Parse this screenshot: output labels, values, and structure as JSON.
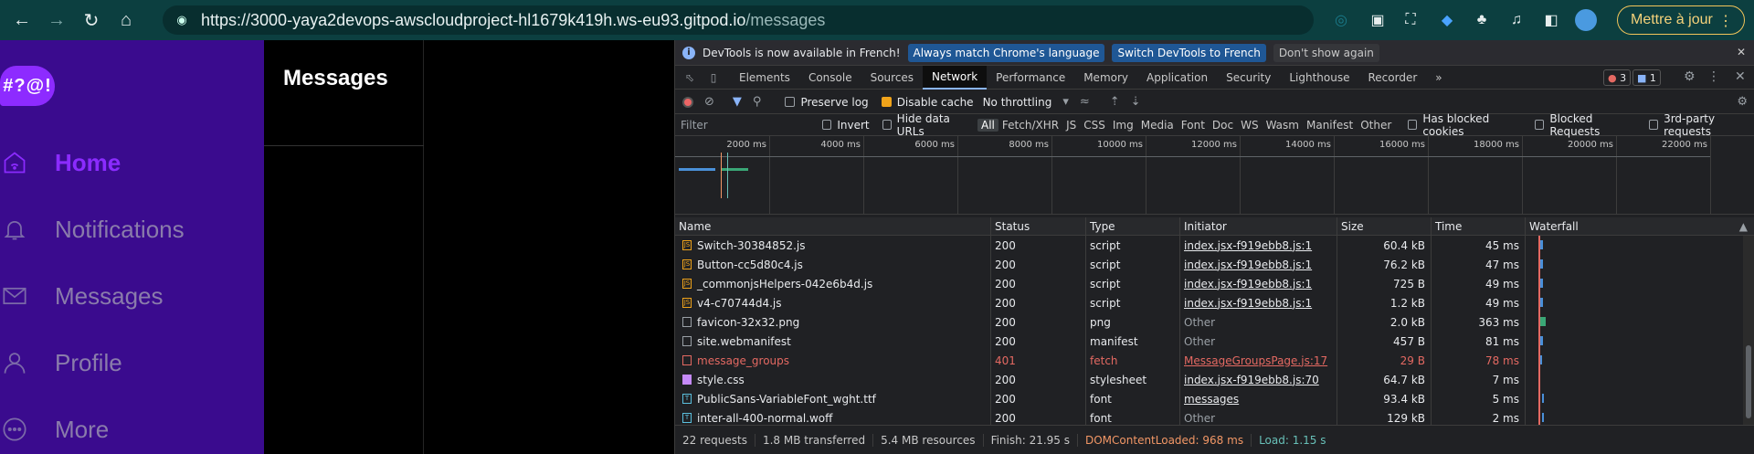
{
  "browser": {
    "url_host": "https://3000-yaya2devops-awscloudproject-hl1679k419h.ws-eu93.gitpod.io",
    "url_path": "/messages",
    "update_button": "Mettre à jour"
  },
  "app": {
    "logo_text": "#?@!",
    "menu": [
      {
        "label": "Home",
        "icon": "home-icon",
        "active": true
      },
      {
        "label": "Notifications",
        "icon": "bell-icon",
        "active": false
      },
      {
        "label": "Messages",
        "icon": "mail-icon",
        "active": false
      },
      {
        "label": "Profile",
        "icon": "user-icon",
        "active": false
      },
      {
        "label": "More",
        "icon": "more-icon",
        "active": false
      }
    ],
    "page_title": "Messages"
  },
  "devtools": {
    "infobar": {
      "message": "DevTools is now available in French!",
      "btn_match": "Always match Chrome's language",
      "btn_switch": "Switch DevTools to French",
      "btn_dismiss": "Don't show again"
    },
    "tabs": [
      "Elements",
      "Console",
      "Sources",
      "Network",
      "Performance",
      "Memory",
      "Application",
      "Security",
      "Lighthouse",
      "Recorder"
    ],
    "active_tab": "Network",
    "error_count": "3",
    "message_count": "1",
    "toolbar": {
      "preserve_log": "Preserve log",
      "disable_cache": "Disable cache",
      "throttling": "No throttling"
    },
    "filter": {
      "placeholder": "Filter",
      "invert": "Invert",
      "hide_data_urls": "Hide data URLs",
      "types": [
        "All",
        "Fetch/XHR",
        "JS",
        "CSS",
        "Img",
        "Media",
        "Font",
        "Doc",
        "WS",
        "Wasm",
        "Manifest",
        "Other"
      ],
      "has_blocked_cookies": "Has blocked cookies",
      "blocked_requests": "Blocked Requests",
      "third_party": "3rd-party requests"
    },
    "timeline_labels": [
      "2000 ms",
      "4000 ms",
      "6000 ms",
      "8000 ms",
      "10000 ms",
      "12000 ms",
      "14000 ms",
      "16000 ms",
      "18000 ms",
      "20000 ms",
      "22000 ms"
    ],
    "columns": [
      "Name",
      "Status",
      "Type",
      "Initiator",
      "Size",
      "Time",
      "Waterfall"
    ],
    "rows": [
      {
        "name": "Switch-30384852.js",
        "status": "200",
        "type": "script",
        "initiator": "index.jsx-f919ebb8.js:1",
        "size": "60.4 kB",
        "time": "45 ms",
        "icon": "js",
        "err": false,
        "link": true
      },
      {
        "name": "Button-cc5d80c4.js",
        "status": "200",
        "type": "script",
        "initiator": "index.jsx-f919ebb8.js:1",
        "size": "76.2 kB",
        "time": "47 ms",
        "icon": "js",
        "err": false,
        "link": true
      },
      {
        "name": "_commonjsHelpers-042e6b4d.js",
        "status": "200",
        "type": "script",
        "initiator": "index.jsx-f919ebb8.js:1",
        "size": "725 B",
        "time": "49 ms",
        "icon": "js",
        "err": false,
        "link": true
      },
      {
        "name": "v4-c70744d4.js",
        "status": "200",
        "type": "script",
        "initiator": "index.jsx-f919ebb8.js:1",
        "size": "1.2 kB",
        "time": "49 ms",
        "icon": "js",
        "err": false,
        "link": true
      },
      {
        "name": "favicon-32x32.png",
        "status": "200",
        "type": "png",
        "initiator": "Other",
        "size": "2.0 kB",
        "time": "363 ms",
        "icon": "gray",
        "err": false,
        "link": false
      },
      {
        "name": "site.webmanifest",
        "status": "200",
        "type": "manifest",
        "initiator": "Other",
        "size": "457 B",
        "time": "81 ms",
        "icon": "gray",
        "err": false,
        "link": false
      },
      {
        "name": "message_groups",
        "status": "401",
        "type": "fetch",
        "initiator": "MessageGroupsPage.js:17",
        "size": "29 B",
        "time": "78 ms",
        "icon": "red",
        "err": true,
        "link": true
      },
      {
        "name": "style.css",
        "status": "200",
        "type": "stylesheet",
        "initiator": "index.jsx-f919ebb8.js:70",
        "size": "64.7 kB",
        "time": "7 ms",
        "icon": "purple",
        "err": false,
        "link": true
      },
      {
        "name": "PublicSans-VariableFont_wght.ttf",
        "status": "200",
        "type": "font",
        "initiator": "messages",
        "size": "93.4 kB",
        "time": "5 ms",
        "icon": "teal",
        "err": false,
        "link": true
      },
      {
        "name": "inter-all-400-normal.woff",
        "status": "200",
        "type": "font",
        "initiator": "Other",
        "size": "129 kB",
        "time": "2 ms",
        "icon": "teal",
        "err": false,
        "link": false
      }
    ],
    "status": {
      "requests": "22 requests",
      "transferred": "1.8 MB transferred",
      "resources": "5.4 MB resources",
      "finish": "Finish: 21.95 s",
      "dom": "DOMContentLoaded: 968 ms",
      "load": "Load: 1.15 s"
    },
    "colors": {
      "accent": "#8ab4f8",
      "error": "#e46962",
      "sidebar": "#3a0b8e",
      "brand": "#8b2bff"
    }
  }
}
